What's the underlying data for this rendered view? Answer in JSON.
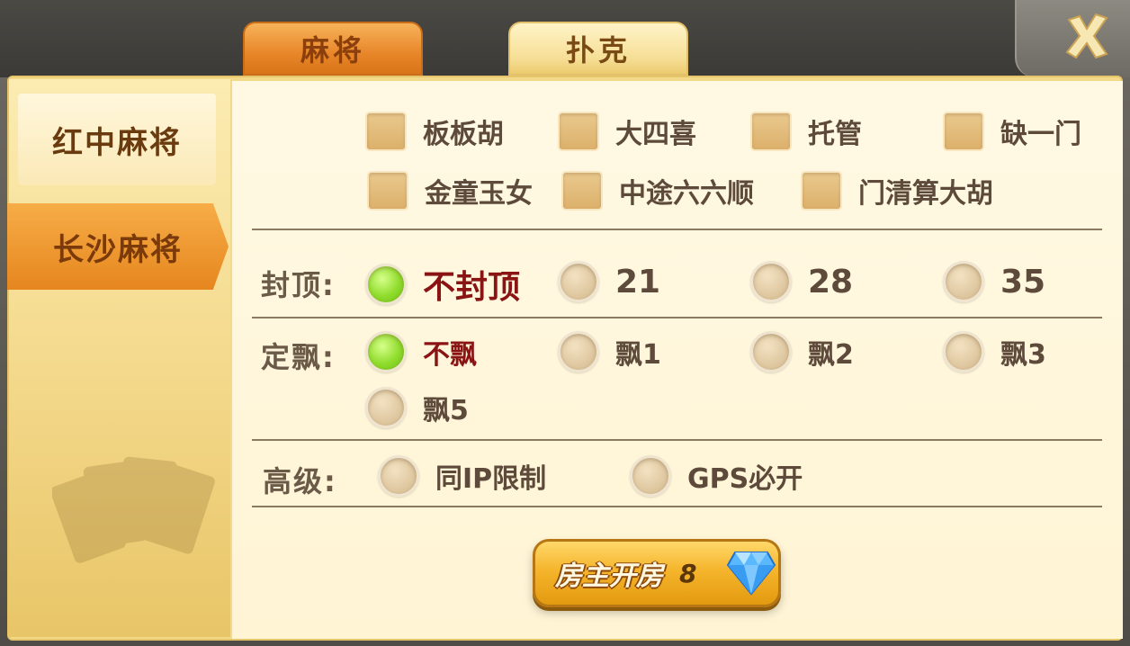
{
  "tabs": [
    {
      "label": "麻将",
      "active": true
    },
    {
      "label": "扑克",
      "active": false
    }
  ],
  "close_icon": "close-x-icon",
  "sidebar": {
    "items": [
      {
        "label": "红中麻将",
        "active": false
      },
      {
        "label": "长沙麻将",
        "active": true
      }
    ]
  },
  "rules": {
    "options": [
      {
        "label": "板板胡",
        "checked": false
      },
      {
        "label": "大四喜",
        "checked": false
      },
      {
        "label": "托管",
        "checked": false
      },
      {
        "label": "缺一门",
        "checked": false
      },
      {
        "label": "金童玉女",
        "checked": false
      },
      {
        "label": "中途六六顺",
        "checked": false
      },
      {
        "label": "门清算大胡",
        "checked": false
      }
    ]
  },
  "cap": {
    "label": "封顶:",
    "options": [
      "不封顶",
      "21",
      "28",
      "35"
    ],
    "selected": "不封顶"
  },
  "piao": {
    "label": "定飘:",
    "options": [
      "不飘",
      "飘1",
      "飘2",
      "飘3",
      "飘5"
    ],
    "selected": "不飘"
  },
  "advanced": {
    "label": "高级:",
    "options": [
      "同IP限制",
      "GPS必开"
    ]
  },
  "create_button": {
    "label": "房主开房",
    "cost": "8",
    "icon": "diamond-icon"
  },
  "colors": {
    "selected_radio": "#8fdc2c",
    "selected_text": "#8a1414",
    "active_tab": "#e8862a"
  }
}
